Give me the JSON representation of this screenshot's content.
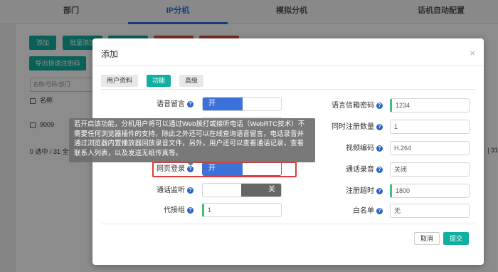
{
  "top_tabs": [
    "部门",
    "IP分机",
    "模拟分机",
    "话机自动配置"
  ],
  "background": {
    "buttons": [
      "添加",
      "批量添加",
      "",
      "",
      ""
    ],
    "export_button": "导出快速注册码",
    "search_placeholder": "名称/号码/部门",
    "column_name": "名称",
    "row_value": "9009",
    "footer_text": "0 选中 / 31 全",
    "pager_text": "| 31"
  },
  "modal": {
    "title": "添加",
    "close_glyph": "×",
    "tabs": [
      "用户资料",
      "功能",
      "高级"
    ],
    "active_tab": "功能",
    "left_fields": {
      "voicemail_label": "语音留言",
      "voicemail_on": "开",
      "webphone_label": "网页登录",
      "webphone_on": "开",
      "monitor_label": "通话监听",
      "monitor_off": "关",
      "pickup_label": "代接组",
      "pickup_value": "1"
    },
    "right_fields": {
      "vm_password_label": "语言信箱密码",
      "vm_password_value": "1234",
      "concurrent_label": "同时注册数量",
      "concurrent_value": "1",
      "video_codec_label": "视频编码",
      "video_codec_value": "H.264",
      "recording_label": "通话录音",
      "recording_value": "关闭",
      "reg_timeout_label": "注册超时",
      "reg_timeout_value": "1800",
      "whitelist_label": "白名单",
      "whitelist_value": "无"
    },
    "tooltip_text": "若开启该功能，分机用户将可以通过Web拨打或接听电话（WebRTC技术）不需要任何浏览器插件的支持，除此之外还可以在线查询语音留言，电话录音并通过浏览器内置播放器回放录音文件，另外，用户还可以查看通话记录，查看联系人列表，以及发送无纸传真等。",
    "cancel_label": "取消",
    "submit_label": "提交"
  },
  "colors": {
    "accent": "#10b0a0",
    "toggle_on": "#3b72d9",
    "highlight": "#e23a3a",
    "help_icon": "#2b64c8"
  }
}
